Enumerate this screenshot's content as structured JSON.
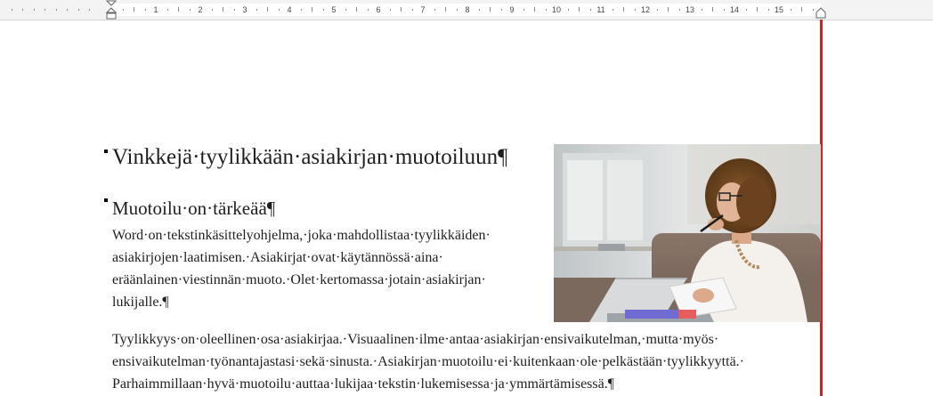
{
  "ruler": {
    "numbers": [
      "1",
      "2",
      "3",
      "4",
      "5",
      "6",
      "7",
      "8",
      "9",
      "10",
      "11",
      "12",
      "13",
      "14",
      "15"
    ]
  },
  "document": {
    "heading1": "Vinkkejä·tyylikkään·asiakirjan·muotoiluun¶",
    "heading2": "Muotoilu·on·tärkeää¶",
    "paragraph1_lines": [
      "Word·on·tekstinkäsittelyohjelma,·joka·mahdollistaa·tyylikkäiden·",
      "asiakirjojen·laatimisen.·Asiakirjat·ovat·käytännössä·aina·",
      "eräänlainen·viestinnän·muoto.·Olet·kertomassa·jotain·asiakirjan·",
      "lukijalle.¶"
    ],
    "paragraph2_lines": [
      "Tyylikkyys·on·oleellinen·osa·asiakirjaa.·Visuaalinen·ilme·antaa·asiakirjan·ensivaikutelman,·mutta·myös·",
      "ensivaikutelman·työnantajastasi·sekä·sinusta.·Asiakirjan·muotoilu·ei·kuitenkaan·ole·pelkästään·tyylikkyyttä.·",
      "Parhaimmillaan·hyvä·muotoilu·auttaa·lukijaa·tekstin·lukemisessa·ja·ymmärtämisessä.¶"
    ]
  },
  "colors": {
    "margin_line": "#e21b1b",
    "ruler_bg": "#f3f3f3"
  },
  "icons": {
    "image": "woman-with-laptop-photo"
  }
}
